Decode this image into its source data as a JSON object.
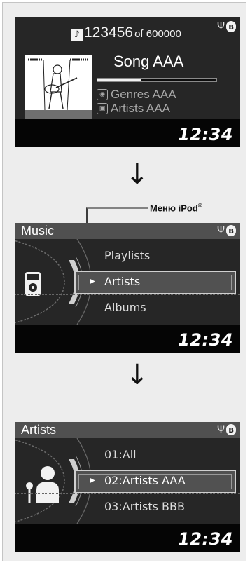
{
  "screen1": {
    "track_number": "123456",
    "track_of": "of 600000",
    "song": "Song AAA",
    "genre": "Genres AAA",
    "artist": "Artists AAA",
    "progress": 0.37,
    "clock": "12:34"
  },
  "callout": {
    "label": "Меню iPod",
    "mark": "®"
  },
  "screen2": {
    "title": "Music",
    "items": [
      "Playlists",
      "Artists",
      "Albums"
    ],
    "selected_index": 1,
    "clock": "12:34"
  },
  "screen3": {
    "title": "Artists",
    "items": [
      "01:All",
      "02:Artists AAA",
      "03:Artists BBB"
    ],
    "selected_index": 1,
    "clock": "12:34"
  },
  "arrows": [
    "↓",
    "↓"
  ],
  "icons": {
    "usb": "usb-icon",
    "bluetooth": "bluetooth-icon",
    "note": "music-note-icon"
  }
}
